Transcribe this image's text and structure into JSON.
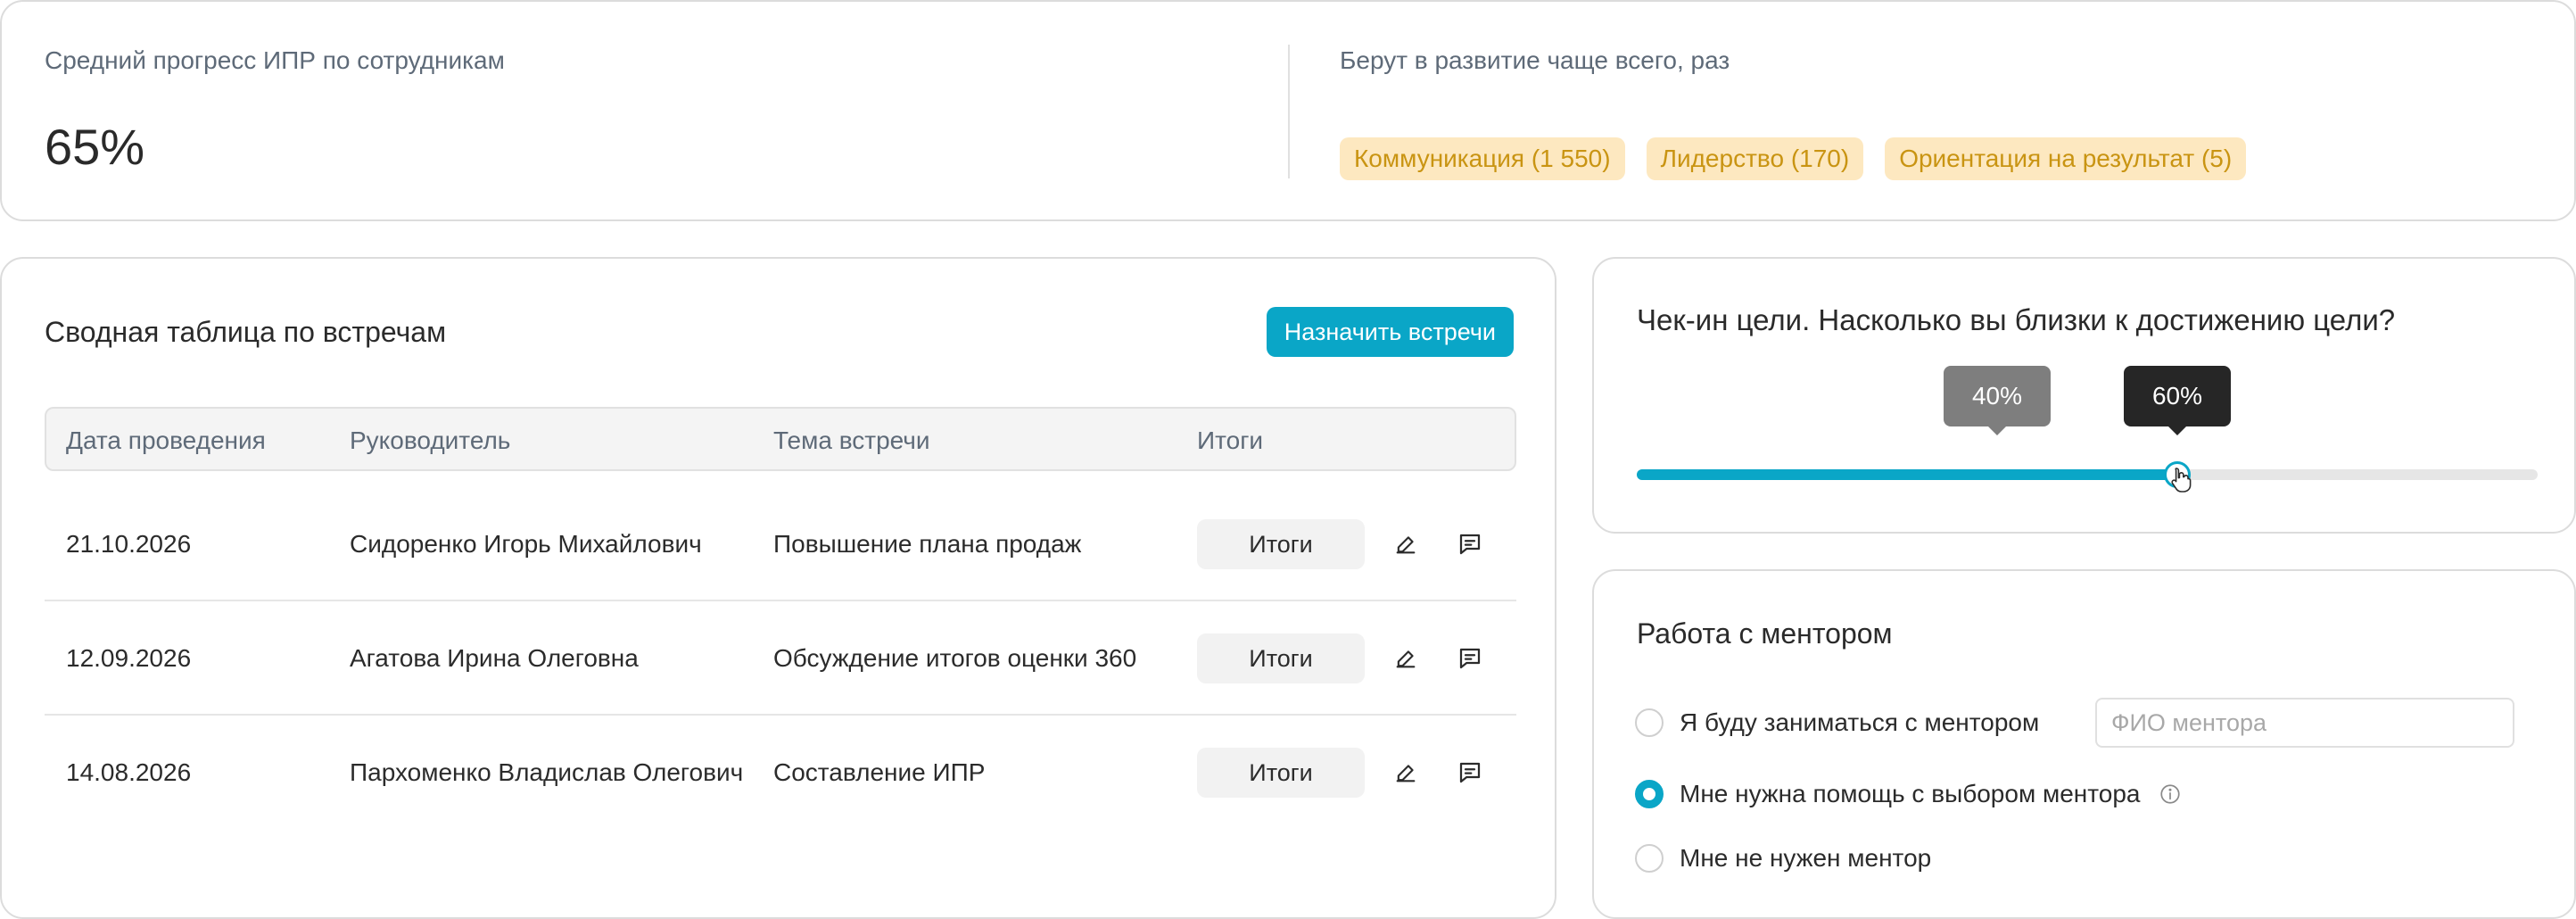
{
  "stats": {
    "avg_progress_title": "Средний прогресс ИПР по сотрудникам",
    "avg_progress_value": "65%",
    "popular_title": "Берут в развитие чаще всего, раз",
    "tags": [
      "Коммуникация (1 550)",
      "Лидерство (170)",
      "Ориентация на результат (5)"
    ]
  },
  "meetings": {
    "title": "Сводная таблица по встречам",
    "assign_button": "Назначить встречи",
    "columns": [
      "Дата проведения",
      "Руководитель",
      "Тема встречи",
      "Итоги"
    ],
    "rows": [
      {
        "date": "21.10.2026",
        "lead": "Сидоренко Игорь Михайлович",
        "topic": "Повышение плана продаж",
        "result_button": "Итоги"
      },
      {
        "date": "12.09.2026",
        "lead": "Агатова Ирина Олеговна",
        "topic": "Обсуждение итогов оценки 360",
        "result_button": "Итоги"
      },
      {
        "date": "14.08.2026",
        "lead": "Пархоменко Владислав Олегович",
        "topic": "Составление ИПР",
        "result_button": "Итоги"
      }
    ]
  },
  "checkin": {
    "title": "Чек-ин цели. Насколько вы близки к достижению цели?",
    "previous_label": "40%",
    "previous_value": 40,
    "current_label": "60%",
    "current_value": 60,
    "accent": "#0aa6c7"
  },
  "mentor": {
    "title": "Работа с ментором",
    "options": [
      "Я буду заниматься с ментором",
      "Мне нужна помощь с выбором ментора",
      "Мне не нужен ментор"
    ],
    "selected_index": 1,
    "input_placeholder": "ФИО ментора"
  }
}
